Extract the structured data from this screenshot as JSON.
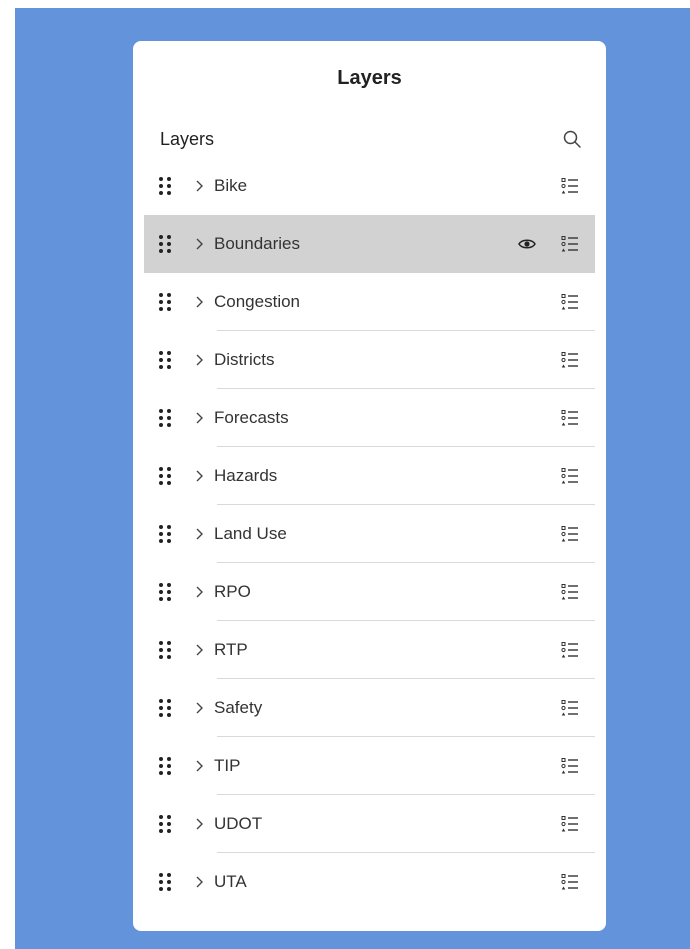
{
  "panel": {
    "title": "Layers"
  },
  "list": {
    "title": "Layers",
    "search_icon": "search-icon"
  },
  "colors": {
    "background": "#6393db",
    "selected_row": "#d2d2d2"
  },
  "layers": [
    {
      "label": "Bike",
      "selected": false
    },
    {
      "label": "Boundaries",
      "selected": true,
      "visible_icon": "eye-icon"
    },
    {
      "label": "Congestion",
      "selected": false
    },
    {
      "label": "Districts",
      "selected": false
    },
    {
      "label": "Forecasts",
      "selected": false
    },
    {
      "label": "Hazards",
      "selected": false
    },
    {
      "label": "Land Use",
      "selected": false
    },
    {
      "label": "RPO",
      "selected": false
    },
    {
      "label": "RTP",
      "selected": false
    },
    {
      "label": "Safety",
      "selected": false
    },
    {
      "label": "TIP",
      "selected": false
    },
    {
      "label": "UDOT",
      "selected": false
    },
    {
      "label": "UTA",
      "selected": false
    }
  ]
}
